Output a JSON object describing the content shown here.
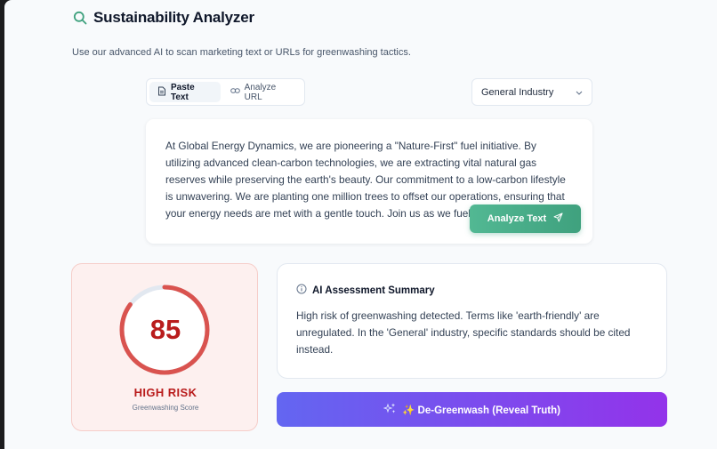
{
  "header": {
    "title": "Sustainability Analyzer",
    "subtitle": "Use our advanced AI to scan marketing text or URLs for greenwashing tactics."
  },
  "tabs": [
    {
      "label": "Paste Text",
      "icon": "document-icon",
      "active": true
    },
    {
      "label": "Analyze URL",
      "icon": "link-icon",
      "active": false
    }
  ],
  "industry": {
    "selected": "General Industry"
  },
  "input": {
    "text": "At Global Energy Dynamics, we are pioneering a \"Nature-First\" fuel initiative. By utilizing advanced clean-carbon technologies, we are extracting vital natural gas reserves while preserving the earth's beauty. Our commitment to a low-carbon lifestyle is unwavering. We are planting one million trees to offset our operations, ensuring that your energy needs are met with a gentle touch. Join us as we fuel"
  },
  "analyze_button": {
    "label": "Analyze Text"
  },
  "score": {
    "value": 85,
    "max": 100,
    "risk_label": "HIGH RISK",
    "caption": "Greenwashing Score",
    "color": "#d9534f"
  },
  "summary": {
    "title": "AI Assessment Summary",
    "text": "High risk of greenwashing detected. Terms like 'earth-friendly' are unregulated. In the 'General' industry, specific standards should be cited instead."
  },
  "degreenwash_button": {
    "label": "✨ De-Greenwash (Reveal Truth)"
  },
  "colors": {
    "accent_green": "#3fa17e",
    "risk_red": "#b91c1c",
    "purple_start": "#6366f1",
    "purple_end": "#9333ea"
  }
}
